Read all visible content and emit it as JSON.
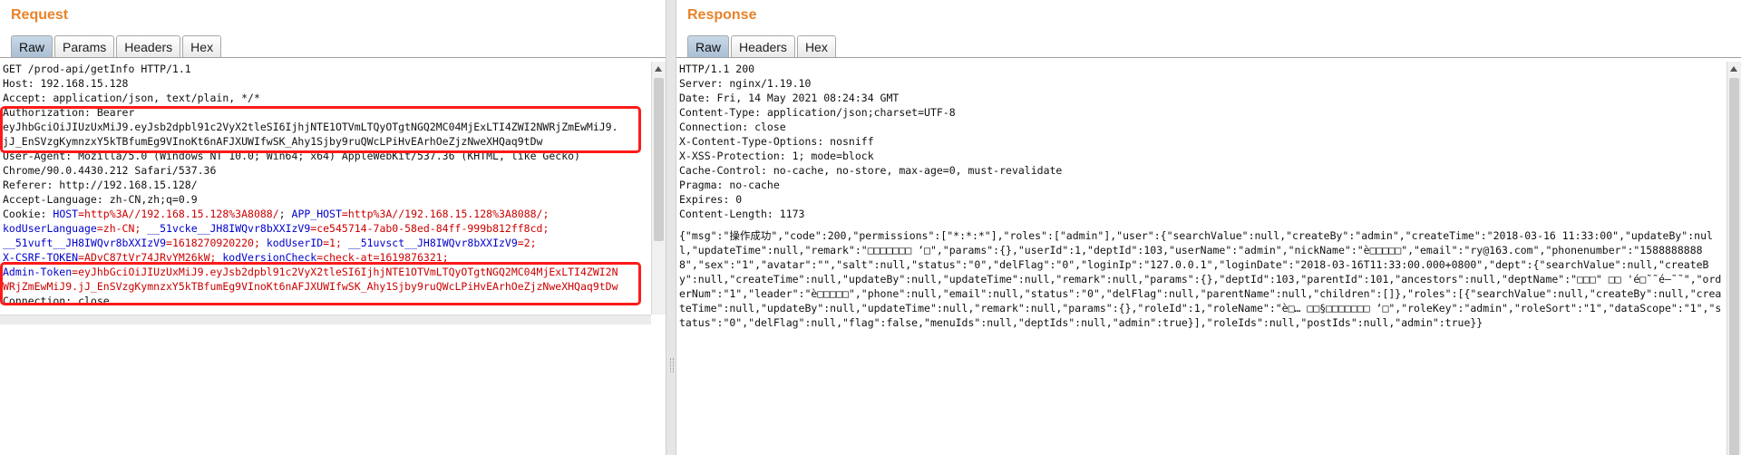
{
  "request": {
    "title": "Request",
    "tabs": [
      "Raw",
      "Params",
      "Headers",
      "Hex"
    ],
    "active_tab": "Raw",
    "lines": [
      "GET /prod-api/getInfo HTTP/1.1",
      "Host: 192.168.15.128",
      "Accept: application/json, text/plain, */*",
      "Authorization: Bearer",
      "eyJhbGciOiJIUzUxMiJ9.eyJsb2dpbl91c2VyX2tleSI6IjhjNTE1OTVmLTQyOTgtNGQ2MC04MjExLTI4ZWI2NWRjZmEwMiJ9.",
      "jJ_EnSVzgKymnzxY5kTBfumEg9VInoKt6nAFJXUWIfwSK_Ahy1Sjby9ruQWcLPiHvEArhOeZjzNweXHQaq9tDw",
      "User-Agent: Mozilla/5.0 (Windows NT 10.0; Win64; x64) AppleWebKit/537.36 (KHTML, like Gecko)",
      "Chrome/90.0.4430.212 Safari/537.36",
      "Referer: http://192.168.15.128/",
      "Accept-Language: zh-CN,zh;q=0.9"
    ],
    "cookie_label": "Cookie: ",
    "cookie_rows": [
      [
        [
          "HOST",
          "=http%3A//192.168.15.128%3A8088/"
        ],
        [
          "APP_HOST",
          "=http%3A//192.168.15.128%3A8088/;"
        ]
      ],
      [
        [
          "kodUserLanguage",
          "=zh-CN;"
        ],
        [
          "__51vcke__JH8IWQvr8bXXIzV9",
          "=ce545714-7ab0-58ed-84ff-999b812ff8cd;"
        ]
      ],
      [
        [
          "__51vuft__JH8IWQvr8bXXIzV9",
          "=1618270920220;"
        ],
        [
          "kodUserID",
          "=1;"
        ],
        [
          "__51uvsct__JH8IWQvr8bXXIzV9",
          "=2;"
        ]
      ],
      [
        [
          "X-CSRF-TOKEN",
          "=ADvC87tVr74JRvYM26kW;"
        ],
        [
          "kodVersionCheck",
          "=check-at=1619876321;"
        ]
      ]
    ],
    "admin_token_key": "Admin-Token",
    "admin_token_value_1": "=eyJhbGciOiJIUzUxMiJ9.eyJsb2dpbl91c2VyX2tleSI6IjhjNTE1OTVmLTQyOTgtNGQ2MC04MjExLTI4ZWI2N",
    "admin_token_value_2": "WRjZmEwMiJ9.jJ_EnSVzgKymnzxY5kTBfumEg9VInoKt6nAFJXUWIfwSK_Ahy1Sjby9ruQWcLPiHvEArhOeZjzNweXHQaq9tDw",
    "last_line": "Connection: close"
  },
  "response": {
    "title": "Response",
    "tabs": [
      "Raw",
      "Headers",
      "Hex"
    ],
    "active_tab": "Raw",
    "lines": [
      "HTTP/1.1 200",
      "Server: nginx/1.19.10",
      "Date: Fri, 14 May 2021 08:24:34 GMT",
      "Content-Type: application/json;charset=UTF-8",
      "Connection: close",
      "X-Content-Type-Options: nosniff",
      "X-XSS-Protection: 1; mode=block",
      "Cache-Control: no-cache, no-store, max-age=0, must-revalidate",
      "Pragma: no-cache",
      "Expires: 0",
      "Content-Length: 1173"
    ],
    "body": "{\"msg\":\"操作成功\",\"code\":200,\"permissions\":[\"*:*:*\"],\"roles\":[\"admin\"],\"user\":{\"searchValue\":null,\"createBy\":\"admin\",\"createTime\":\"2018-03-16 11:33:00\",\"updateBy\":null,\"updateTime\":null,\"remark\":\"□□□□□□□ ‘□\",\"params\":{},\"userId\":1,\"deptId\":103,\"userName\":\"admin\",\"nickName\":\"è□□□□□\",\"email\":\"ry@163.com\",\"phonenumber\":\"15888888888\",\"sex\":\"1\",\"avatar\":\"\",\"salt\":null,\"status\":\"0\",\"delFlag\":\"0\",\"loginIp\":\"127.0.0.1\",\"loginDate\":\"2018-03-16T11:33:00.000+0800\",\"dept\":{\"searchValue\":null,\"createBy\":null,\"createTime\":null,\"updateBy\":null,\"updateTime\":null,\"remark\":null,\"params\":{},\"deptId\":103,\"parentId\":101,\"ancestors\":null,\"deptName\":\"□□□\" □□ 'é□˜˜é—˜˜\",\"orderNum\":\"1\",\"leader\":\"è□□□□□\",\"phone\":null,\"email\":null,\"status\":\"0\",\"delFlag\":null,\"parentName\":null,\"children\":[]},\"roles\":[{\"searchValue\":null,\"createBy\":null,\"createTime\":null,\"updateBy\":null,\"updateTime\":null,\"remark\":null,\"params\":{},\"roleId\":1,\"roleName\":\"è□… □□§□□□□□□□ ‘□\",\"roleKey\":\"admin\",\"roleSort\":\"1\",\"dataScope\":\"1\",\"status\":\"0\",\"delFlag\":null,\"flag\":false,\"menuIds\":null,\"deptIds\":null,\"admin\":true}],\"roleIds\":null,\"postIds\":null,\"admin\":true}}"
  },
  "colors": {
    "accent": "#e8832a",
    "highlight_border": "#ff1a1a",
    "param_key": "#0000cc",
    "param_value": "#cc0000"
  }
}
